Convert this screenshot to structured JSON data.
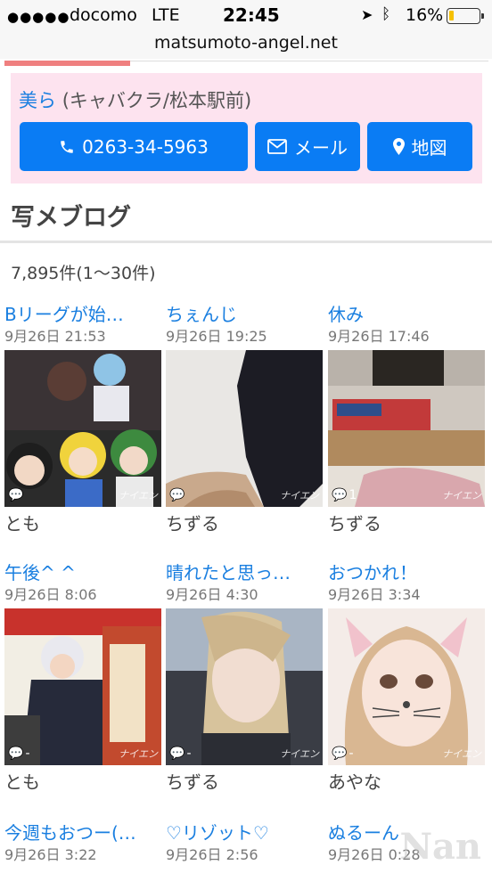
{
  "status_bar": {
    "signal": "●●●●●",
    "carrier": "docomo",
    "network": "LTE",
    "time": "22:45",
    "location_icon": "location-arrow-icon",
    "bluetooth_icon": "bluetooth-icon",
    "battery_percent": "16%",
    "battery_level": 0.16,
    "battery_color": "#f5c000"
  },
  "url": "matsumoto-angel.net",
  "shop": {
    "name": "美ら",
    "meta": "(キャバクラ/松本駅前)",
    "buttons": {
      "phone": "0263-34-5963",
      "mail": "メール",
      "map": "地図"
    },
    "accent_color": "#0a7cf4",
    "background_color": "#fde3ef"
  },
  "section": {
    "title": "写メブログ",
    "count": "7,895件(1〜30件)"
  },
  "posts": [
    {
      "title": "Bリーグが始…",
      "date": "9月26日 21:53",
      "author": "とも",
      "comments": "",
      "watermark": "ナイエン"
    },
    {
      "title": "ちぇんじ",
      "date": "9月26日 19:25",
      "author": "ちずる",
      "comments": "",
      "watermark": "ナイエン"
    },
    {
      "title": "休み",
      "date": "9月26日 17:46",
      "author": "ちずる",
      "comments": "1",
      "watermark": "ナイエン"
    },
    {
      "title": "午後^ ^",
      "date": "9月26日 8:06",
      "author": "とも",
      "comments": "-",
      "watermark": "ナイエン"
    },
    {
      "title": "晴れたと思っ…",
      "date": "9月26日 4:30",
      "author": "ちずる",
      "comments": "-",
      "watermark": "ナイエン"
    },
    {
      "title": "おつかれ！",
      "date": "9月26日 3:34",
      "author": "あやな",
      "comments": "-",
      "watermark": "ナイエン"
    },
    {
      "title": "今週もおつー(…",
      "date": "9月26日 3:22",
      "author": "",
      "comments": "",
      "watermark": ""
    },
    {
      "title": "♡リゾット♡",
      "date": "9月26日 2:56",
      "author": "",
      "comments": "",
      "watermark": ""
    },
    {
      "title": "ぬるーん",
      "date": "9月26日 0:28",
      "author": "",
      "comments": "",
      "watermark": ""
    }
  ],
  "site_watermark": "Nan"
}
